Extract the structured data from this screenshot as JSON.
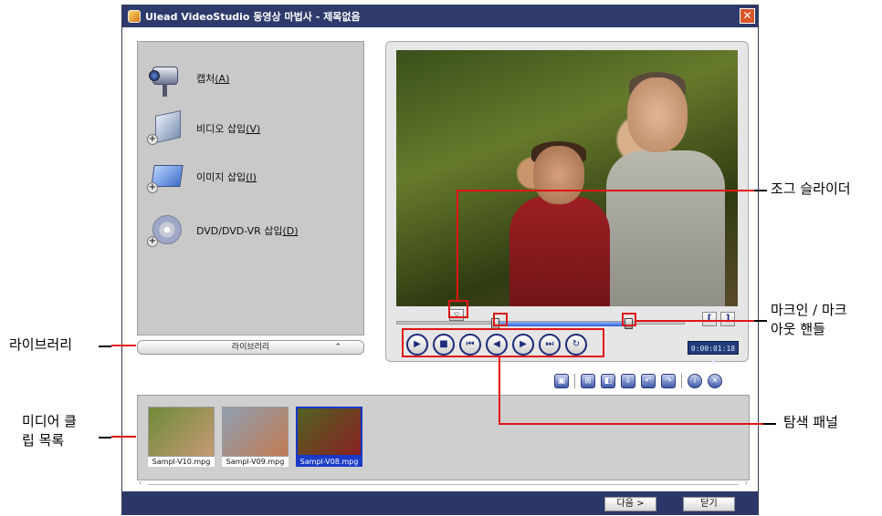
{
  "window": {
    "title": "Ulead VideoStudio 동영상 마법사 - 제목없음",
    "close_glyph": "✕"
  },
  "left_panel": {
    "items": [
      {
        "label": "캡처",
        "hotkey": "(A)",
        "icon": "camcorder-icon"
      },
      {
        "label": "비디오 삽입",
        "hotkey": "(V)",
        "icon": "insert-video-icon"
      },
      {
        "label": "이미지 삽입",
        "hotkey": "(I)",
        "icon": "insert-image-icon"
      },
      {
        "label": "DVD/DVD-VR 삽입",
        "hotkey": "(D)",
        "icon": "insert-dvd-icon"
      }
    ],
    "library_button": "라이브러리",
    "library_arrow": "⌃"
  },
  "preview": {
    "jog_glyph": "▽",
    "mark_in": "[",
    "mark_out": "]",
    "nav_buttons": [
      {
        "name": "play-button",
        "glyph": "▶"
      },
      {
        "name": "stop-button",
        "glyph": "■"
      },
      {
        "name": "home-button",
        "glyph": "⏮"
      },
      {
        "name": "previous-frame-button",
        "glyph": "◀"
      },
      {
        "name": "next-frame-button",
        "glyph": "▶"
      },
      {
        "name": "end-button",
        "glyph": "⏭"
      },
      {
        "name": "repeat-button",
        "glyph": "↻"
      }
    ],
    "timecode": "0:00:01:18",
    "timecode_arrows": "♦"
  },
  "toolbar": {
    "icons": [
      "capture-frame-icon",
      "split-icon",
      "snapshot-icon",
      "export-icon",
      "rotate-left-icon",
      "rotate-right-icon",
      "info-icon",
      "delete-icon"
    ],
    "glyphs": [
      "▣",
      "⊞",
      "◧",
      "⇩",
      "↶",
      "↷",
      "i",
      "✕"
    ]
  },
  "clips": [
    {
      "label": "Sampl-V10.mpg",
      "selected": false,
      "colors": [
        "#6f8a3a",
        "#c69a74"
      ]
    },
    {
      "label": "Sampl-V09.mpg",
      "selected": false,
      "colors": [
        "#8fa0b2",
        "#c27a52"
      ]
    },
    {
      "label": "Sampl-V08.mpg",
      "selected": true,
      "colors": [
        "#4f6322",
        "#8a2022"
      ]
    }
  ],
  "scroll": {
    "left": "‹",
    "right": "›"
  },
  "bottom": {
    "next_button": "다음 >",
    "close_button": "닫기"
  },
  "annotations": {
    "jog_slider": "조그 슬라이더",
    "mark_handles_line1": "마크인 / 마크",
    "mark_handles_line2": "아웃 핸들",
    "library": "라이브러리",
    "media_clip_line1": "미디어 클",
    "media_clip_line2": "립 목록",
    "nav_panel": "탐색 패널"
  },
  "colors": {
    "accent_red": "#e01515",
    "titlebar": "#2d3a6b",
    "selection_blue": "#1c3cc8"
  }
}
